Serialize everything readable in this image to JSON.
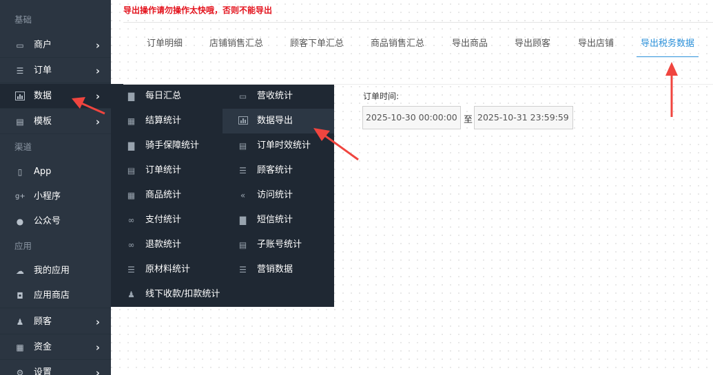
{
  "warning": "导出操作请勿操作太快哦，否则不能导出",
  "sidebar": {
    "sections": [
      "基础",
      "渠道",
      "应用"
    ],
    "items": [
      {
        "label": "商户",
        "icon": "laptop-icon",
        "chevron": "›"
      },
      {
        "label": "订单",
        "icon": "list-icon",
        "chevron": "›"
      },
      {
        "label": "数据",
        "icon": "bar-chart-icon",
        "chevron": "›"
      },
      {
        "label": "模板",
        "icon": "table-icon",
        "chevron": "›"
      },
      {
        "label": "App",
        "icon": "mobile-icon"
      },
      {
        "label": "小程序",
        "icon": "google-plus-icon"
      },
      {
        "label": "公众号",
        "icon": "chat-icon"
      },
      {
        "label": "我的应用",
        "icon": "cloud-icon"
      },
      {
        "label": "应用商店",
        "icon": "coffee-icon"
      },
      {
        "label": "顾客",
        "icon": "users-icon",
        "chevron": "›"
      },
      {
        "label": "资金",
        "icon": "qrcode-icon",
        "chevron": "›"
      },
      {
        "label": "设置",
        "icon": "gear-icon",
        "chevron": "›"
      }
    ]
  },
  "flyout": {
    "left": [
      {
        "label": "每日汇总",
        "icon": "file-icon"
      },
      {
        "label": "结算统计",
        "icon": "calendar-icon"
      },
      {
        "label": "骑手保障统计",
        "icon": "file-icon"
      },
      {
        "label": "订单统计",
        "icon": "table-icon"
      },
      {
        "label": "商品统计",
        "icon": "grid-icon"
      },
      {
        "label": "支付统计",
        "icon": "link-icon"
      },
      {
        "label": "退款统计",
        "icon": "link-icon"
      },
      {
        "label": "原材料统计",
        "icon": "list-ol-icon"
      },
      {
        "label": "线下收款/扣款统计",
        "icon": "users-icon"
      }
    ],
    "right": [
      {
        "label": "营收统计",
        "icon": "credit-card-icon"
      },
      {
        "label": "数据导出",
        "icon": "bar-chart-icon"
      },
      {
        "label": "订单时效统计",
        "icon": "table-icon"
      },
      {
        "label": "顾客统计",
        "icon": "indent-icon"
      },
      {
        "label": "访问统计",
        "icon": "double-angle-left-icon"
      },
      {
        "label": "短信统计",
        "icon": "file-icon"
      },
      {
        "label": "子账号统计",
        "icon": "list-alt-icon"
      },
      {
        "label": "营销数据",
        "icon": "list-ol-icon"
      }
    ]
  },
  "tabs": [
    "订单明细",
    "店铺销售汇总",
    "顾客下单汇总",
    "商品销售汇总",
    "导出商品",
    "导出顾客",
    "导出店铺",
    "导出税务数据"
  ],
  "active_tab": "导出税务数据",
  "filter": {
    "label": "订单时间:",
    "start": "2025-10-30 00:00:00",
    "to": "至",
    "end": "2025-10-31 23:59:59"
  },
  "colors": {
    "sidebar_bg": "#2b3541",
    "flyout_bg": "#1f2833",
    "accent": "#2b90d9",
    "warning": "#e4131d",
    "arrow": "#f0453f"
  }
}
